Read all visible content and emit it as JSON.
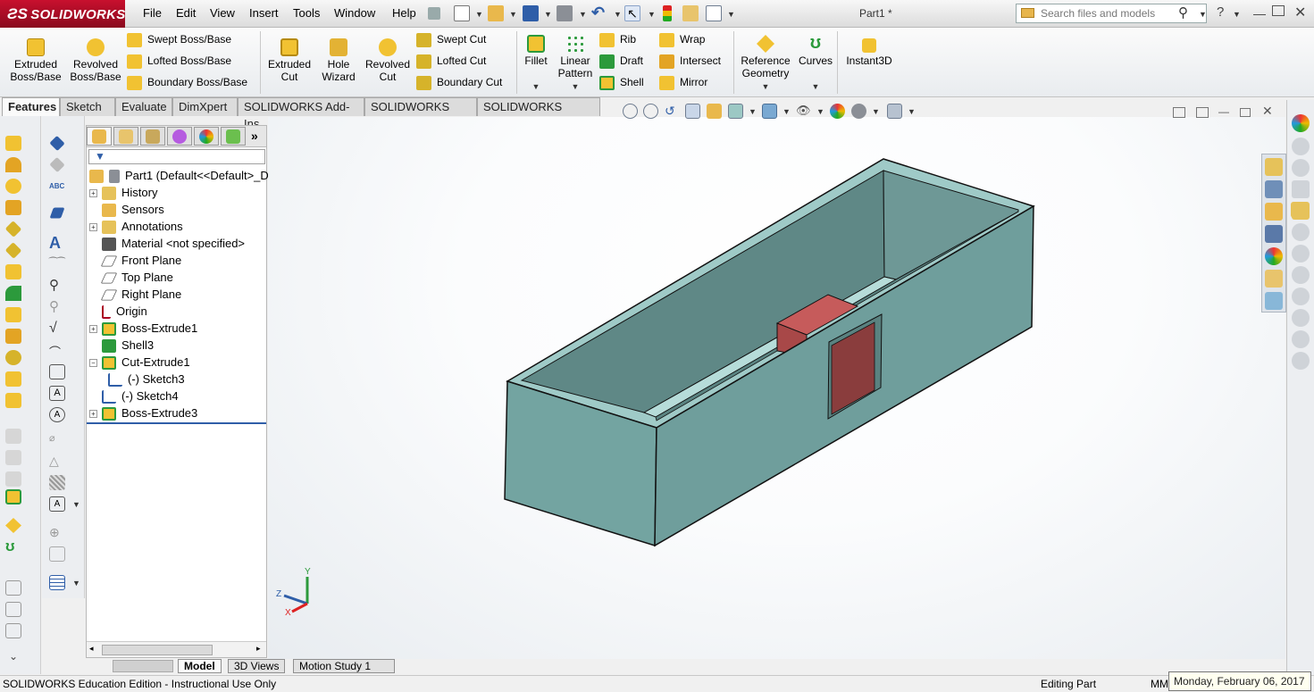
{
  "app": {
    "name": "SOLIDWORKS",
    "document_title": "Part1 *"
  },
  "menu": [
    "File",
    "Edit",
    "View",
    "Insert",
    "Tools",
    "Window",
    "Help"
  ],
  "search": {
    "placeholder": "Search files and models"
  },
  "command_manager": {
    "extruded_boss": "Extruded\nBoss/Base",
    "revolved_boss": "Revolved\nBoss/Base",
    "swept_boss": "Swept Boss/Base",
    "lofted_boss": "Lofted Boss/Base",
    "boundary_boss": "Boundary Boss/Base",
    "extruded_cut": "Extruded\nCut",
    "hole_wizard": "Hole\nWizard",
    "revolved_cut": "Revolved\nCut",
    "swept_cut": "Swept Cut",
    "lofted_cut": "Lofted Cut",
    "boundary_cut": "Boundary Cut",
    "fillet": "Fillet",
    "linear_pattern": "Linear\nPattern",
    "rib": "Rib",
    "draft": "Draft",
    "shell": "Shell",
    "wrap": "Wrap",
    "intersect": "Intersect",
    "mirror": "Mirror",
    "reference_geometry": "Reference\nGeometry",
    "curves": "Curves",
    "instant3d": "Instant3D"
  },
  "tabs": [
    "Features",
    "Sketch",
    "Evaluate",
    "DimXpert",
    "SOLIDWORKS Add-Ins",
    "SOLIDWORKS MBD",
    "SOLIDWORKS Plastics"
  ],
  "tree": {
    "root": "Part1  (Default<<Default>_D",
    "items": [
      {
        "label": "History",
        "expandable": true,
        "icon": "history-icon"
      },
      {
        "label": "Sensors",
        "expandable": false,
        "icon": "sensor-icon"
      },
      {
        "label": "Annotations",
        "expandable": true,
        "icon": "annotation-icon"
      },
      {
        "label": "Material <not specified>",
        "expandable": false,
        "icon": "material-icon"
      },
      {
        "label": "Front Plane",
        "expandable": false,
        "icon": "plane-icon"
      },
      {
        "label": "Top Plane",
        "expandable": false,
        "icon": "plane-icon"
      },
      {
        "label": "Right Plane",
        "expandable": false,
        "icon": "plane-icon"
      },
      {
        "label": "Origin",
        "expandable": false,
        "icon": "origin-icon"
      },
      {
        "label": "Boss-Extrude1",
        "expandable": true,
        "icon": "extrude-icon"
      },
      {
        "label": "Shell3",
        "expandable": false,
        "icon": "shell-icon"
      },
      {
        "label": "Cut-Extrude1",
        "expandable": true,
        "expanded": true,
        "icon": "cut-extrude-icon"
      },
      {
        "label": "(-) Sketch3",
        "expandable": false,
        "child": true,
        "icon": "sketch-icon"
      },
      {
        "label": "(-) Sketch4",
        "expandable": false,
        "icon": "sketch-icon"
      },
      {
        "label": "Boss-Extrude3",
        "expandable": true,
        "icon": "extrude-icon"
      }
    ]
  },
  "bottom_tabs": [
    "Model",
    "3D Views",
    "Motion Study 1"
  ],
  "status": {
    "left": "SOLIDWORKS Education Edition - Instructional Use Only",
    "mode": "Editing Part",
    "units": "MM"
  },
  "tooltip": "Monday, February 06, 2017",
  "colors": {
    "model_body": "#6f9e9c",
    "model_top": "#9cc8c4",
    "feature_red": "#b05050",
    "brand": "#c8102e"
  }
}
